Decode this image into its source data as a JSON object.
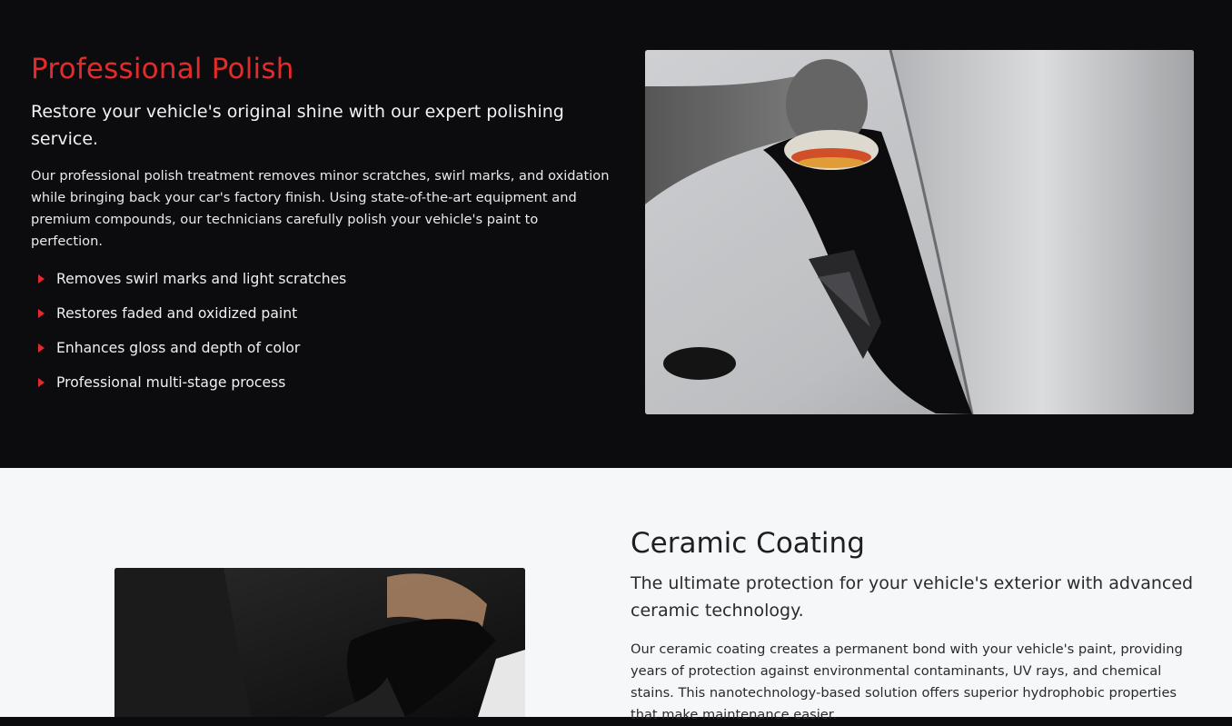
{
  "polish": {
    "title": "Professional Polish",
    "subtitle": "Restore your vehicle's original shine with our expert polishing service.",
    "description": "Our professional polish treatment removes minor scratches, swirl marks, and oxidation while bringing back your car's factory finish. Using state-of-the-art equipment and premium compounds, our technicians carefully polish your vehicle's paint to perfection.",
    "features": [
      "Removes swirl marks and light scratches",
      "Restores faded and oxidized paint",
      "Enhances gloss and depth of color",
      "Professional multi-stage process"
    ],
    "bullet_icon": "caret-right-icon",
    "image_icon": "car-polishing-photo"
  },
  "ceramic": {
    "title": "Ceramic Coating",
    "subtitle": "The ultimate protection for your vehicle's exterior with advanced ceramic technology.",
    "description": "Our ceramic coating creates a permanent bond with your vehicle's paint, providing years of protection against environmental contaminants, UV rays, and chemical stains. This nanotechnology-based solution offers superior hydrophobic properties that make maintenance easier.",
    "image_icon": "ceramic-coating-photo"
  },
  "colors": {
    "accent": "#e32b2b",
    "dark_bg": "#0c0c0e",
    "light_bg": "#f6f7f9"
  }
}
